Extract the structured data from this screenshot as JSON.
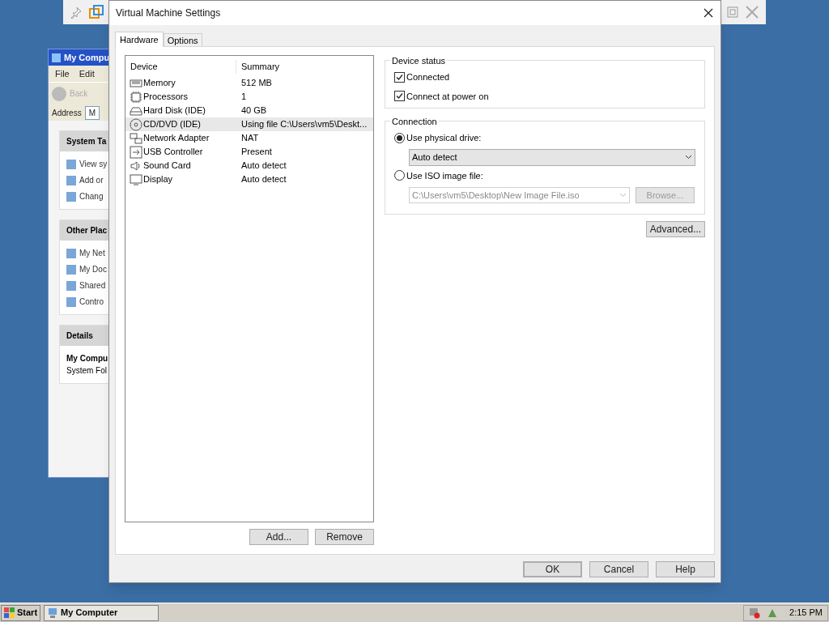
{
  "background_window": {
    "title": "My Compu",
    "menu": [
      "File",
      "Edit"
    ],
    "back": "Back",
    "address_label": "Address",
    "address_value": "M",
    "panels": [
      {
        "title": "System Ta",
        "items": [
          "View sy",
          "Add or",
          "Chang"
        ]
      },
      {
        "title": "Other Plac",
        "items": [
          "My Net",
          "My Doc",
          "Shared",
          "Contro"
        ]
      }
    ],
    "details": {
      "title": "Details",
      "name": "My Compu",
      "type": "System Fol"
    }
  },
  "dialog": {
    "title": "Virtual Machine Settings",
    "tabs": [
      {
        "label": "Hardware",
        "selected": true
      },
      {
        "label": "Options",
        "selected": false
      }
    ],
    "device_columns": [
      "Device",
      "Summary"
    ],
    "devices": [
      {
        "kind": "memory",
        "name": "Memory",
        "summary": "512 MB",
        "selected": false
      },
      {
        "kind": "cpu",
        "name": "Processors",
        "summary": "1",
        "selected": false
      },
      {
        "kind": "disk",
        "name": "Hard Disk (IDE)",
        "summary": "40 GB",
        "selected": false
      },
      {
        "kind": "cd",
        "name": "CD/DVD (IDE)",
        "summary": "Using file C:\\Users\\vm5\\Deskt...",
        "selected": true
      },
      {
        "kind": "network",
        "name": "Network Adapter",
        "summary": "NAT",
        "selected": false
      },
      {
        "kind": "usb",
        "name": "USB Controller",
        "summary": "Present",
        "selected": false
      },
      {
        "kind": "sound",
        "name": "Sound Card",
        "summary": "Auto detect",
        "selected": false
      },
      {
        "kind": "display",
        "name": "Display",
        "summary": "Auto detect",
        "selected": false
      }
    ],
    "list_buttons": [
      "Add...",
      "Remove"
    ],
    "device_status": {
      "title": "Device status",
      "options": [
        {
          "label": "Connected",
          "checked": true
        },
        {
          "label": "Connect at power on",
          "checked": true
        }
      ]
    },
    "connection": {
      "title": "Connection",
      "physical": {
        "label": "Use physical drive:",
        "selected": true,
        "value": "Auto detect"
      },
      "iso": {
        "label": "Use ISO image file:",
        "selected": false,
        "value": "C:\\Users\\vm5\\Desktop\\New Image File.iso",
        "browse": "Browse..."
      }
    },
    "advanced": "Advanced...",
    "buttons": [
      "OK",
      "Cancel",
      "Help"
    ]
  },
  "taskbar": {
    "start": "Start",
    "task": "My Computer",
    "clock": "2:15 PM"
  }
}
